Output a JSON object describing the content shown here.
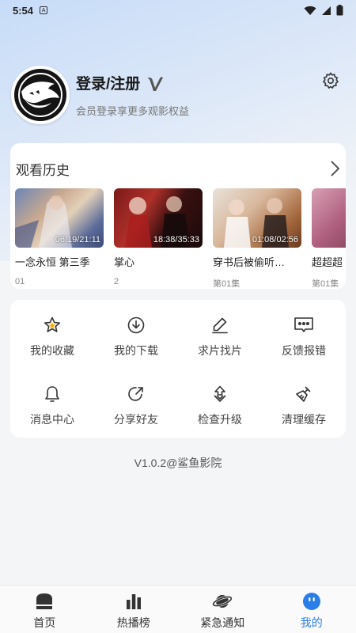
{
  "status_bar": {
    "time": "5:54",
    "sim_label": "A"
  },
  "profile": {
    "login_label": "登录/注册",
    "subtitle": "会员登录享更多观影权益",
    "settings_icon": "gear-icon",
    "vip_icon": "vip-v-icon"
  },
  "history": {
    "title": "观看历史",
    "items": [
      {
        "title": "一念永恒 第三季",
        "progress": "06:19/21:11",
        "episode": "01"
      },
      {
        "title": "掌心",
        "progress": "18:38/35:33",
        "episode": "2"
      },
      {
        "title": "穿书后被偷听…",
        "progress": "01:08/02:56",
        "episode": "第01集"
      },
      {
        "title": "超超超",
        "progress": "",
        "episode": "第01集"
      }
    ]
  },
  "menu": [
    {
      "label": "我的收藏",
      "icon": "star-icon"
    },
    {
      "label": "我的下载",
      "icon": "download-icon"
    },
    {
      "label": "求片找片",
      "icon": "pen-icon"
    },
    {
      "label": "反馈报错",
      "icon": "message-icon"
    },
    {
      "label": "消息中心",
      "icon": "bell-icon"
    },
    {
      "label": "分享好友",
      "icon": "share-icon"
    },
    {
      "label": "检查升级",
      "icon": "upgrade-icon"
    },
    {
      "label": "清理缓存",
      "icon": "broom-icon"
    }
  ],
  "version": "V1.0.2@鲨鱼影院",
  "tabs": [
    {
      "label": "首页",
      "icon": "home-icon",
      "active": false
    },
    {
      "label": "热播榜",
      "icon": "chart-icon",
      "active": false
    },
    {
      "label": "紧急通知",
      "icon": "planet-icon",
      "active": false
    },
    {
      "label": "我的",
      "icon": "face-icon",
      "active": true
    }
  ],
  "colors": {
    "accent": "#2b7de9",
    "background": "#f4f5f7"
  }
}
